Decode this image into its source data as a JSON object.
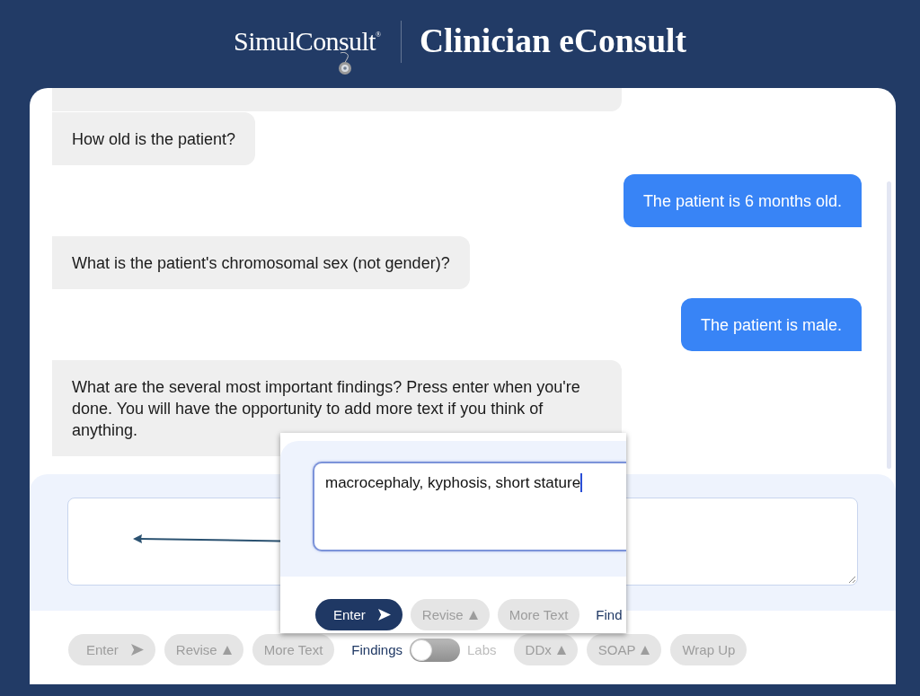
{
  "header": {
    "logo": "SimulConsult$^{®}$",
    "title": "Clinician eConsult"
  },
  "chat": {
    "scrolled_past": true,
    "messages": [
      {
        "kind": "bot",
        "text": "How old is the patient?"
      },
      {
        "kind": "user",
        "text": "The patient is 6 months old."
      },
      {
        "kind": "bot",
        "text": "What is the patient's chromosomal sex (not gender)?"
      },
      {
        "kind": "user",
        "text": "The patient is male."
      },
      {
        "kind": "bot",
        "text": "What are the several most important findings? Press enter when you're done. You will have the opportunity to add more text if you think of anything."
      }
    ]
  },
  "toolbar": {
    "items": [
      {
        "kind": "send",
        "label": "Enter",
        "disabled": true
      },
      {
        "kind": "menu",
        "label": "Revise",
        "disabled": true
      },
      {
        "kind": "plain",
        "label": "More Text",
        "disabled": true
      },
      {
        "kind": "toggle",
        "left_label": "Findings",
        "right_label": "Labs",
        "on": false
      },
      {
        "kind": "menu",
        "label": "DDx",
        "disabled": true
      },
      {
        "kind": "menu",
        "label": "SOAP",
        "disabled": true
      },
      {
        "kind": "plain",
        "label": "Wrap Up",
        "disabled": true
      }
    ]
  },
  "zoom_callout": {
    "input_value": "macrocephaly, kyphosis, short stature",
    "buttons": [
      {
        "kind": "send",
        "label": "Enter",
        "disabled": false
      },
      {
        "kind": "menu",
        "label": "Revise",
        "disabled": true
      },
      {
        "kind": "plain",
        "label": "More Text",
        "disabled": true
      },
      {
        "kind": "link",
        "label": "Find"
      }
    ]
  }
}
